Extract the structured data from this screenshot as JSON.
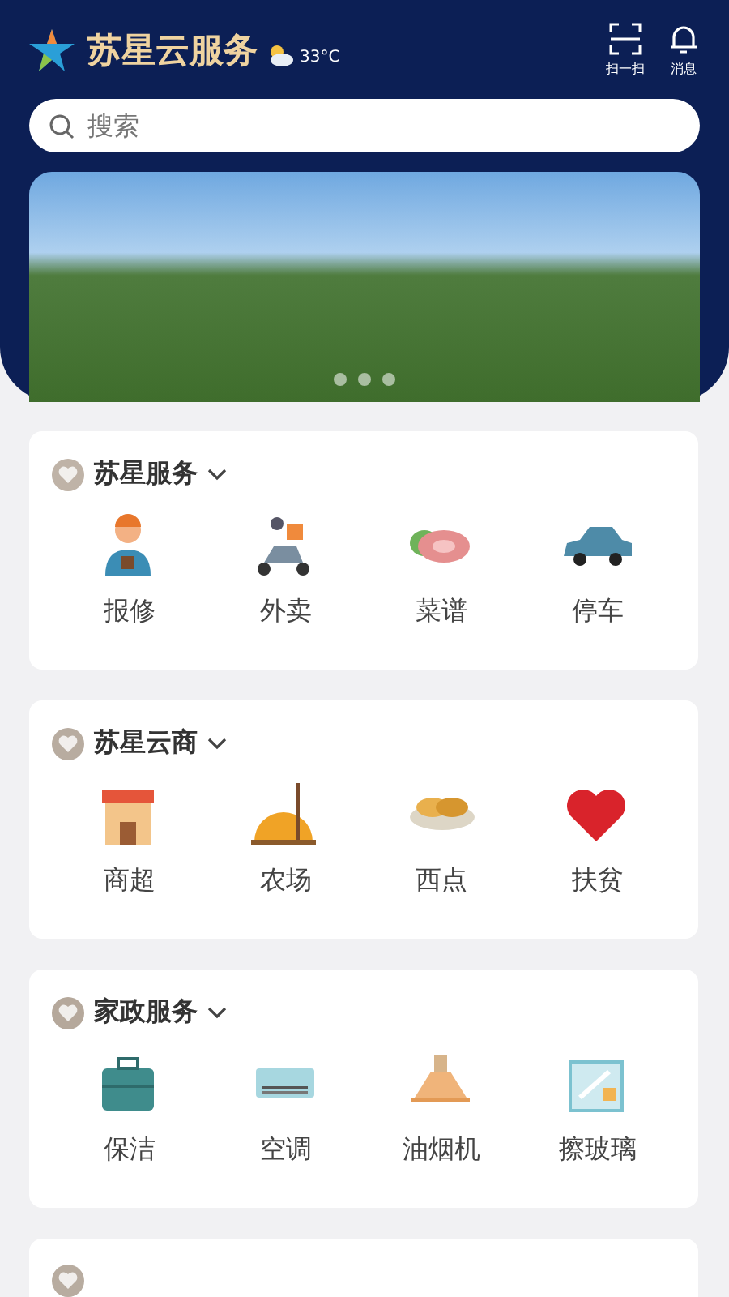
{
  "header": {
    "title": "苏星云服务",
    "temperature": "33°C",
    "actions": [
      {
        "label": "扫一扫"
      },
      {
        "label": "消息"
      }
    ]
  },
  "search": {
    "placeholder": "搜索"
  },
  "sections": [
    {
      "title": "苏星服务",
      "items": [
        {
          "label": "报修"
        },
        {
          "label": "外卖"
        },
        {
          "label": "菜谱"
        },
        {
          "label": "停车"
        }
      ]
    },
    {
      "title": "苏星云商",
      "items": [
        {
          "label": "商超"
        },
        {
          "label": "农场"
        },
        {
          "label": "西点"
        },
        {
          "label": "扶贫"
        }
      ]
    },
    {
      "title": "家政服务",
      "items": [
        {
          "label": "保洁"
        },
        {
          "label": "空调"
        },
        {
          "label": "油烟机"
        },
        {
          "label": "擦玻璃"
        }
      ]
    }
  ]
}
